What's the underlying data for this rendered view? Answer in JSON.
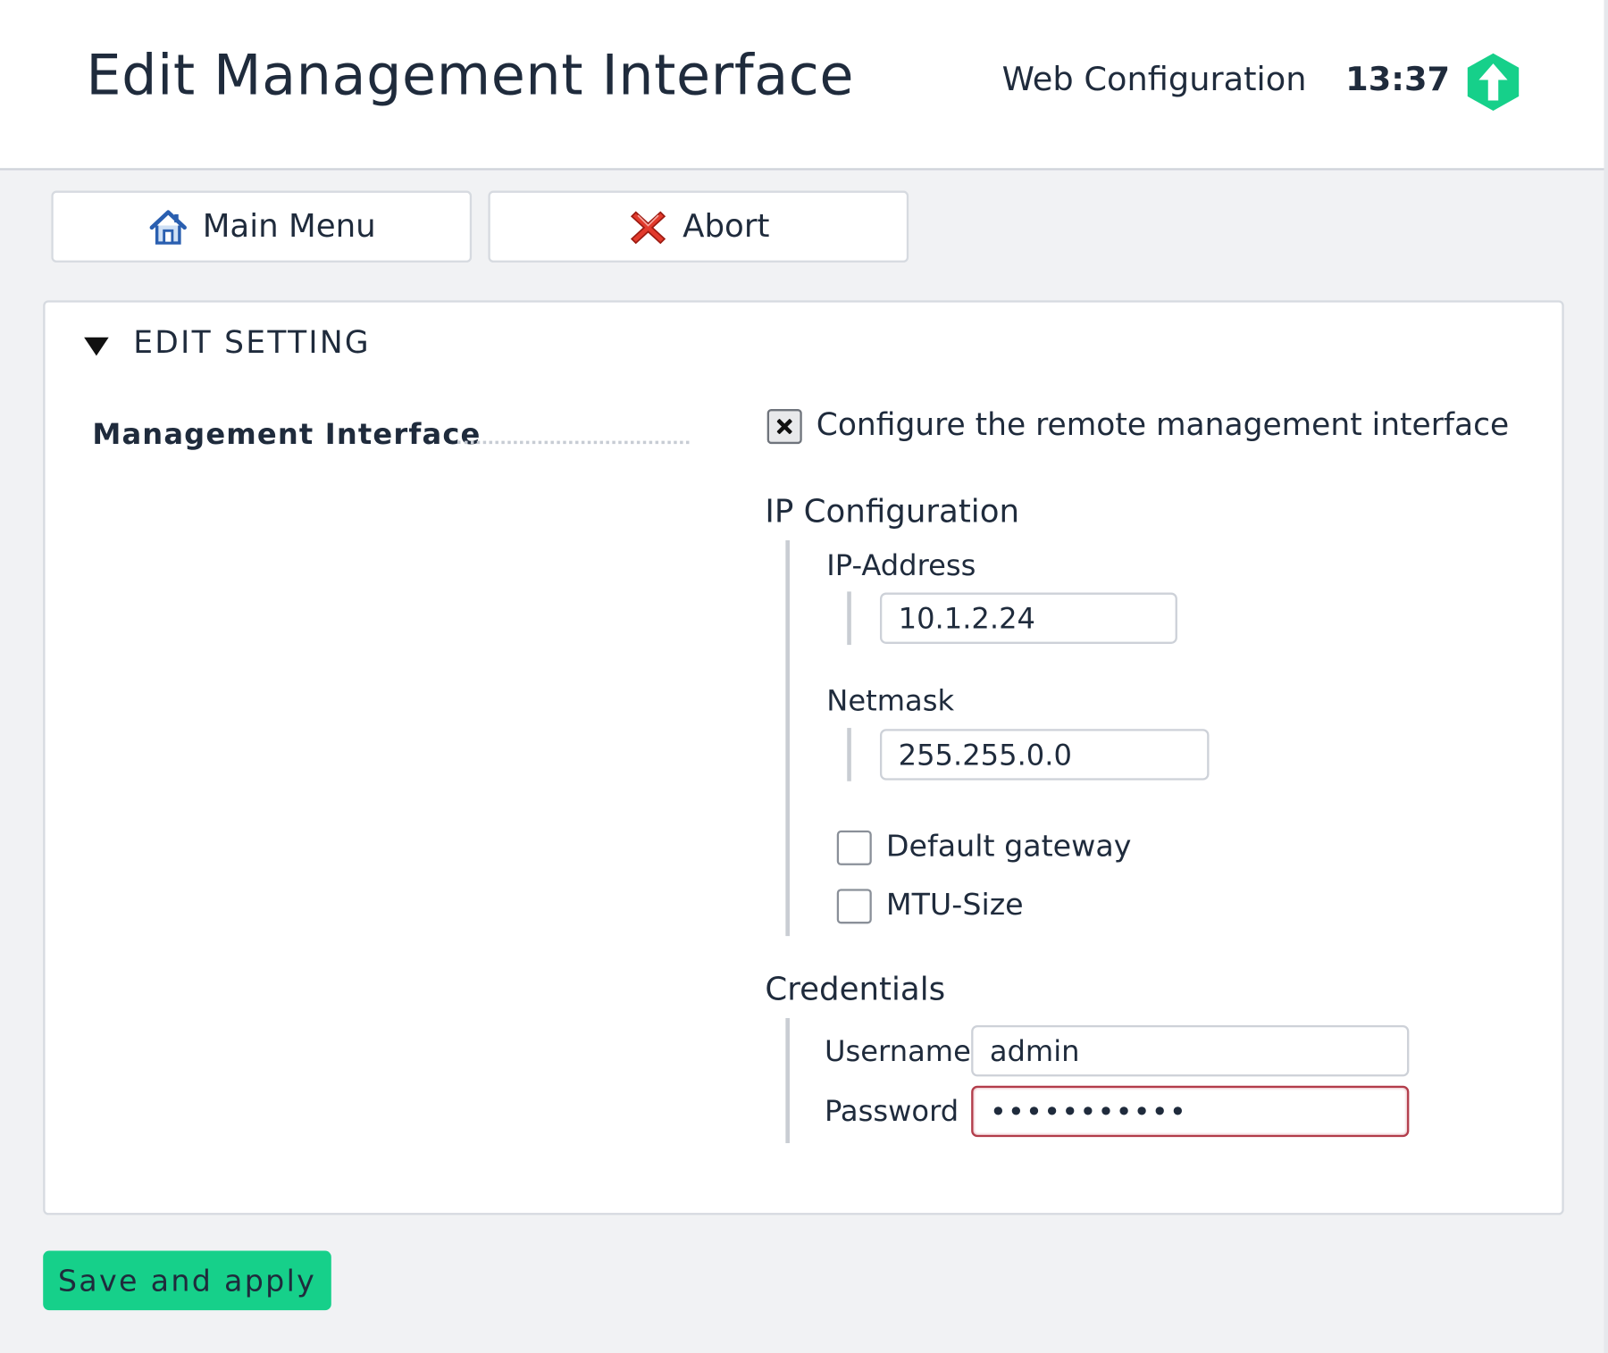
{
  "header": {
    "title": "Edit Management Interface",
    "site": "Web Configuration",
    "clock": "13:37",
    "logo_icon": "up-arrow-hexagon-icon",
    "logo_color": "#16d08a"
  },
  "toolbar": {
    "main_menu_label": "Main Menu",
    "main_menu_icon": "home-icon",
    "abort_label": "Abort",
    "abort_icon": "red-x-icon"
  },
  "panel": {
    "title": "EDIT SETTING",
    "setting_label": "Management Interface",
    "configure": {
      "label": "Configure the remote management interface",
      "checked": true
    },
    "ip_configuration": {
      "heading": "IP Configuration",
      "ip_address_label": "IP-Address",
      "ip_address_value": "10.1.2.24",
      "netmask_label": "Netmask",
      "netmask_value": "255.255.0.0",
      "default_gateway_label": "Default gateway",
      "default_gateway_checked": false,
      "mtu_label": "MTU-Size",
      "mtu_checked": false
    },
    "credentials": {
      "heading": "Credentials",
      "username_label": "Username",
      "username_value": "admin",
      "password_label": "Password",
      "password_value": "•••••••••••"
    }
  },
  "actions": {
    "save_label": "Save and apply",
    "save_color": "#16d08a"
  }
}
